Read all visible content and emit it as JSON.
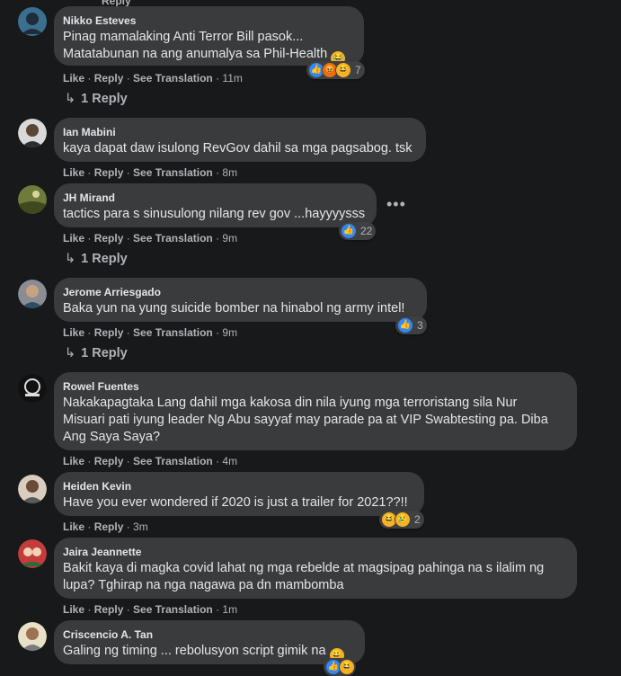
{
  "colors": {
    "background": "#18191a",
    "bubble": "#3a3b3c",
    "text": "#e4e6eb",
    "muted": "#b0b3b8",
    "like_blue": "#2e89ff"
  },
  "top_partial": "Reply",
  "actions": {
    "like": "Like",
    "reply": "Reply",
    "see_translation": "See Translation",
    "sep": " · "
  },
  "comments": [
    {
      "author": "Nikko Esteves",
      "lines": [
        "Pinag mamalaking Anti Terror Bill pasok...",
        "Matatabunan na ang anumalya sa Phil-Health"
      ],
      "time": "11m",
      "reaction_count": "7",
      "reactions": [
        "like-icon",
        "angry-icon",
        "haha-icon"
      ],
      "replies": "1 Reply"
    },
    {
      "author": "Ian Mabini",
      "lines": [
        "kaya dapat daw isulong RevGov dahil sa mga pagsabog. tsk"
      ],
      "time": "8m"
    },
    {
      "author": "JH Mirand",
      "lines": [
        "tactics para s sinusulong nilang rev gov ...hayyyysss"
      ],
      "time": "9m",
      "reaction_count": "22",
      "replies": "1 Reply",
      "more": "•••"
    },
    {
      "author": "Jerome Arriesgado",
      "lines": [
        "Baka yun na yung suicide bomber na hinabol ng army intel!"
      ],
      "time": "9m",
      "reaction_count": "3",
      "replies": "1 Reply"
    },
    {
      "author": "Rowel Fuentes",
      "lines": [
        "Nakakapagtaka Lang dahil mga kakosa din nila iyung mga terroristang sila Nur",
        "Misuari pati iyung leader Ng Abu sayyaf may parade pa at VIP Swabtesting pa. Diba",
        "Ang Saya Saya?"
      ],
      "time": "4m"
    },
    {
      "author": "Heiden Kevin",
      "lines": [
        "Have you ever wondered if 2020 is just a trailer for 2021??!!"
      ],
      "time": "3m",
      "reaction_count": "2"
    },
    {
      "author": "Jaira Jeannette",
      "lines": [
        "Bakit kaya di magka covid lahat ng mga rebelde at magsipag pahinga na s ilalim ng",
        "lupa? Tghirap na nga nagawa pa dn mambomba"
      ],
      "time": "1m"
    },
    {
      "author": "Criscencio A. Tan",
      "lines": [
        "Galing ng timing ... rebolusyon script gimik na"
      ]
    }
  ]
}
